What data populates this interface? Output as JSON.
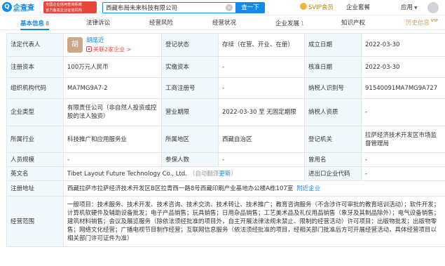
{
  "header": {
    "logo_text": "企查查",
    "logo_sub": "Qcc.com",
    "logo_mark": "Q",
    "slogan_line1": "全国企业信用查询系统",
    "slogan_line2": "官方备案企业征信机构",
    "search_value": "西藏布局未来科技有限公司",
    "search_clear": "×",
    "search_button": "查一下",
    "svip_label": "SVIP会员",
    "enterprise_kit": "企业套餐",
    "apps": "应用"
  },
  "tabs": [
    {
      "label": "基本信息",
      "count": "8"
    },
    {
      "label": "法律诉讼",
      "count": ""
    },
    {
      "label": "经营风险",
      "count": ""
    },
    {
      "label": "经营状况",
      "count": ""
    },
    {
      "label": "企业发展",
      "count": "1"
    },
    {
      "label": "知识产权",
      "count": ""
    },
    {
      "label": "历史信息",
      "count": "",
      "badge": "VIP"
    }
  ],
  "info": {
    "legal_rep_label": "法定代表人",
    "legal_rep_avatar": "胡",
    "legal_rep_name": "胡席近",
    "legal_rep_related": "关联2家企业 >",
    "reg_status_label": "登记状态",
    "reg_status": "存续（在营、开业、在册）",
    "established_label": "成立日期",
    "established": "2022-03-30",
    "reg_capital_label": "注册资本",
    "reg_capital": "100万元人民币",
    "paid_capital_label": "实缴资本",
    "paid_capital": "-",
    "approval_date_label": "核准日期",
    "approval_date": "2022-03-30",
    "org_code_label": "组织机构代码",
    "org_code": "MA7MG9A7-2",
    "biz_reg_no_label": "工商注册号",
    "biz_reg_no": "-",
    "taxpayer_id_label": "纳税人识别号",
    "taxpayer_id": "91540091MA7MG9A727",
    "company_type_label": "企业类型",
    "company_type": "有限责任公司（非自然人投资或控股的法人独资）",
    "biz_term_label": "营业期限",
    "biz_term": "2022-03-30 至 无固定期限",
    "taxpayer_qual_label": "纳税人资质",
    "taxpayer_qual": "-",
    "industry_label": "所属行业",
    "industry": "科技推广和应用服务业",
    "region_label": "所属地区",
    "region": "西藏自治区",
    "reg_authority_label": "登记机关",
    "reg_authority": "拉萨经济技术开发区市场监督管理局",
    "staff_size_label": "人员规模",
    "staff_size": "-",
    "insured_label": "参保人数",
    "insured": "-",
    "former_name_label": "曾用名",
    "former_name": "-",
    "english_name_label": "英文名",
    "english_name": "Tibet Layout Future Technology Co., Ltd.",
    "english_name_note": "（自动翻译",
    "english_name_update": "更新",
    "english_name_close": "）",
    "import_export_label": "进出口企业代码",
    "import_export": "-",
    "address_label": "注册地址",
    "address": "西藏拉萨市拉萨经济技术开发区B区拉青西一路8号西藏印刷产业基地办公楼A栋107室",
    "address_link": "附近企业",
    "scope_label": "经营范围",
    "scope": "一般项目：技术服务、技术开发、技术咨询、技术交流、技术转让、技术推广；教育咨询服务（不含涉许可审批的教育培训活动）；软件开发；计算机软硬件及辅助设备批发；电子产品销售；玩具销售；日用杂品销售；工艺美术品及礼仪用品销售（象牙及其制品除外）；电气设备销售；建筑材料销售；会议及展览服务（除依法须经批准的项目外，自主开展法律法规未禁止、限制的经营活动）许可项目：出版物批发；出版物零售；网络文化经营；广播电视节目制作经营；互联网信息服务（依法须经批准的项目，经相关部门批准后方可开展经营活动，具体经营项目以相关部门许可证件为准）"
  }
}
